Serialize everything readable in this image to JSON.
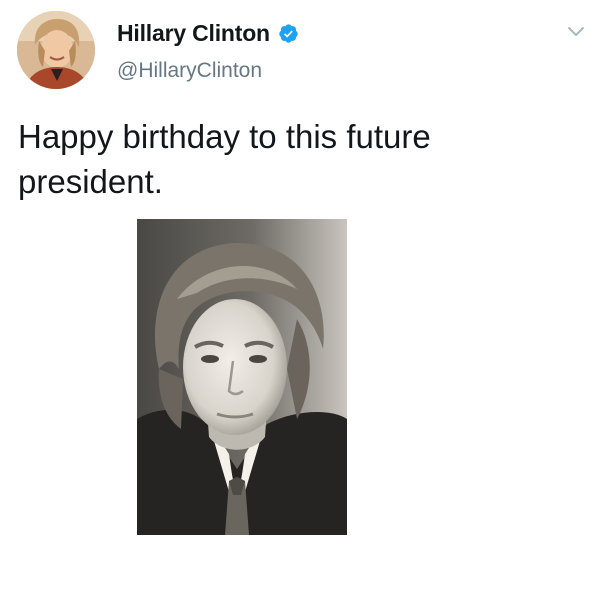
{
  "tweet": {
    "display_name": "Hillary Clinton",
    "handle": "@HillaryClinton",
    "verified": true,
    "text_line_1": "Happy birthday to this future",
    "text_line_2": "president.",
    "avatar_icon": "profile-avatar",
    "verified_icon": "verified-badge-icon",
    "caret_icon": "chevron-down-icon",
    "media": "vintage black-and-white portrait photo"
  },
  "colors": {
    "name": "#14171a",
    "handle": "#657786",
    "verified": "#1da1f2",
    "caret": "#aab8c2"
  }
}
